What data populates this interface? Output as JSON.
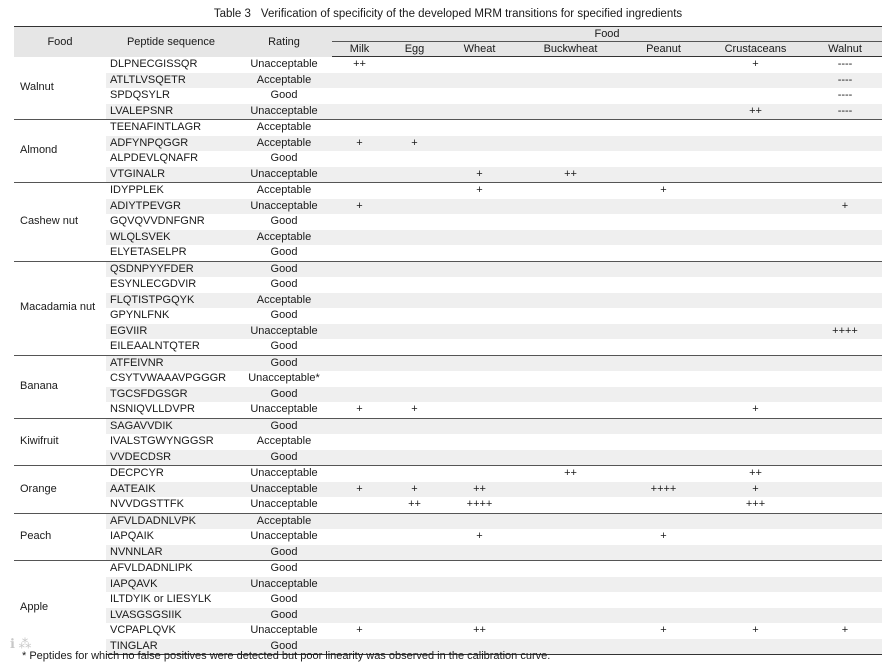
{
  "caption": {
    "number": "Table 3",
    "title": "Verification of specificity of the developed MRM transitions for specified ingredients"
  },
  "header": {
    "food": "Food",
    "peptide": "Peptide sequence",
    "rating": "Rating",
    "food_group": "Food",
    "columns": [
      "Milk",
      "Egg",
      "Wheat",
      "Buckwheat",
      "Peanut",
      "Crustaceans",
      "Walnut"
    ]
  },
  "groups": [
    {
      "food": "Walnut",
      "rows": [
        {
          "peptide": "DLPNECGISSQR",
          "rating": "Unacceptable",
          "cells": [
            "++",
            "",
            "",
            "",
            "",
            "+",
            "----"
          ]
        },
        {
          "peptide": "ATLTLVSQETR",
          "rating": "Acceptable",
          "cells": [
            "",
            "",
            "",
            "",
            "",
            "",
            "----"
          ]
        },
        {
          "peptide": "SPDQSYLR",
          "rating": "Good",
          "cells": [
            "",
            "",
            "",
            "",
            "",
            "",
            "----"
          ]
        },
        {
          "peptide": "LVALEPSNR",
          "rating": "Unacceptable",
          "cells": [
            "",
            "",
            "",
            "",
            "",
            "++",
            "----"
          ]
        }
      ]
    },
    {
      "food": "Almond",
      "rows": [
        {
          "peptide": "TEENAFINTLAGR",
          "rating": "Acceptable",
          "cells": [
            "",
            "",
            "",
            "",
            "",
            "",
            ""
          ]
        },
        {
          "peptide": "ADFYNPQGGR",
          "rating": "Acceptable",
          "cells": [
            "+",
            "+",
            "",
            "",
            "",
            "",
            ""
          ]
        },
        {
          "peptide": "ALPDEVLQNAFR",
          "rating": "Good",
          "cells": [
            "",
            "",
            "",
            "",
            "",
            "",
            ""
          ]
        },
        {
          "peptide": "VTGINALR",
          "rating": "Unacceptable",
          "cells": [
            "",
            "",
            "+",
            "++",
            "",
            "",
            ""
          ]
        }
      ]
    },
    {
      "food": "Cashew nut",
      "rows": [
        {
          "peptide": "IDYPPLEK",
          "rating": "Acceptable",
          "cells": [
            "",
            "",
            "+",
            "",
            "+",
            "",
            ""
          ]
        },
        {
          "peptide": "ADIYTPEVGR",
          "rating": "Unacceptable",
          "cells": [
            "+",
            "",
            "",
            "",
            "",
            "",
            "+"
          ]
        },
        {
          "peptide": "GQVQVVDNFGNR",
          "rating": "Good",
          "cells": [
            "",
            "",
            "",
            "",
            "",
            "",
            ""
          ]
        },
        {
          "peptide": "WLQLSVEK",
          "rating": "Acceptable",
          "cells": [
            "",
            "",
            "",
            "",
            "",
            "",
            ""
          ]
        },
        {
          "peptide": "ELYETASELPR",
          "rating": "Good",
          "cells": [
            "",
            "",
            "",
            "",
            "",
            "",
            ""
          ]
        }
      ]
    },
    {
      "food": "Macadamia nut",
      "rows": [
        {
          "peptide": "QSDNPYYFDER",
          "rating": "Good",
          "cells": [
            "",
            "",
            "",
            "",
            "",
            "",
            ""
          ]
        },
        {
          "peptide": "ESYNLECGDVIR",
          "rating": "Good",
          "cells": [
            "",
            "",
            "",
            "",
            "",
            "",
            ""
          ]
        },
        {
          "peptide": "FLQTISTPGQYK",
          "rating": "Acceptable",
          "cells": [
            "",
            "",
            "",
            "",
            "",
            "",
            ""
          ]
        },
        {
          "peptide": "GPYNLFNK",
          "rating": "Good",
          "cells": [
            "",
            "",
            "",
            "",
            "",
            "",
            ""
          ]
        },
        {
          "peptide": "EGVIIR",
          "rating": "Unacceptable",
          "cells": [
            "",
            "",
            "",
            "",
            "",
            "",
            "++++"
          ]
        },
        {
          "peptide": "EILEAALNTQTER",
          "rating": "Good",
          "cells": [
            "",
            "",
            "",
            "",
            "",
            "",
            ""
          ]
        }
      ]
    },
    {
      "food": "Banana",
      "rows": [
        {
          "peptide": "ATFEIVNR",
          "rating": "Good",
          "cells": [
            "",
            "",
            "",
            "",
            "",
            "",
            ""
          ]
        },
        {
          "peptide": "CSYTVWAAAVPGGGR",
          "rating": "Unacceptable*",
          "cells": [
            "",
            "",
            "",
            "",
            "",
            "",
            ""
          ]
        },
        {
          "peptide": "TGCSFDGSGR",
          "rating": "Good",
          "cells": [
            "",
            "",
            "",
            "",
            "",
            "",
            ""
          ]
        },
        {
          "peptide": "NSNIQVLLDVPR",
          "rating": "Unacceptable",
          "cells": [
            "+",
            "+",
            "",
            "",
            "",
            "+",
            ""
          ]
        }
      ]
    },
    {
      "food": "Kiwifruit",
      "rows": [
        {
          "peptide": "SAGAVVDIK",
          "rating": "Good",
          "cells": [
            "",
            "",
            "",
            "",
            "",
            "",
            ""
          ]
        },
        {
          "peptide": "IVALSTGWYNGGSR",
          "rating": "Acceptable",
          "cells": [
            "",
            "",
            "",
            "",
            "",
            "",
            ""
          ]
        },
        {
          "peptide": "VVDECDSR",
          "rating": "Good",
          "cells": [
            "",
            "",
            "",
            "",
            "",
            "",
            ""
          ]
        }
      ]
    },
    {
      "food": "Orange",
      "rows": [
        {
          "peptide": "DECPCYR",
          "rating": "Unacceptable",
          "cells": [
            "",
            "",
            "",
            "++",
            "",
            "++",
            ""
          ]
        },
        {
          "peptide": "AATEAIK",
          "rating": "Unacceptable",
          "cells": [
            "+",
            "+",
            "++",
            "",
            "++++",
            "+",
            ""
          ]
        },
        {
          "peptide": "NVVDGSTTFK",
          "rating": "Unacceptable",
          "cells": [
            "",
            "++",
            "++++",
            "",
            "",
            "+++",
            ""
          ]
        }
      ]
    },
    {
      "food": "Peach",
      "rows": [
        {
          "peptide": "AFVLDADNLVPK",
          "rating": "Acceptable",
          "cells": [
            "",
            "",
            "",
            "",
            "",
            "",
            ""
          ]
        },
        {
          "peptide": "IAPQAIK",
          "rating": "Unacceptable",
          "cells": [
            "",
            "",
            "+",
            "",
            "+",
            "",
            ""
          ]
        },
        {
          "peptide": "NVNNLAR",
          "rating": "Good",
          "cells": [
            "",
            "",
            "",
            "",
            "",
            "",
            ""
          ]
        }
      ]
    },
    {
      "food": "Apple",
      "rows": [
        {
          "peptide": "AFVLDADNLIPK",
          "rating": "Good",
          "cells": [
            "",
            "",
            "",
            "",
            "",
            "",
            ""
          ]
        },
        {
          "peptide": "IAPQAVK",
          "rating": "Unacceptable",
          "cells": [
            "",
            "",
            "",
            "",
            "",
            "",
            ""
          ]
        },
        {
          "peptide": "ILTDYIK or LIESYLK",
          "rating": "Good",
          "cells": [
            "",
            "",
            "",
            "",
            "",
            "",
            ""
          ]
        },
        {
          "peptide": "LVASGSGSIIK",
          "rating": "Good",
          "cells": [
            "",
            "",
            "",
            "",
            "",
            "",
            ""
          ]
        },
        {
          "peptide": "VCPAPLQVK",
          "rating": "Unacceptable",
          "cells": [
            "+",
            "",
            "++",
            "",
            "+",
            "+",
            "+"
          ]
        },
        {
          "peptide": "TINGLAR",
          "rating": "Good",
          "cells": [
            "",
            "",
            "",
            "",
            "",
            "",
            ""
          ]
        }
      ]
    }
  ],
  "footnote": "* Peptides for which no false positives were detected but poor linearity was observed in the calibration curve."
}
